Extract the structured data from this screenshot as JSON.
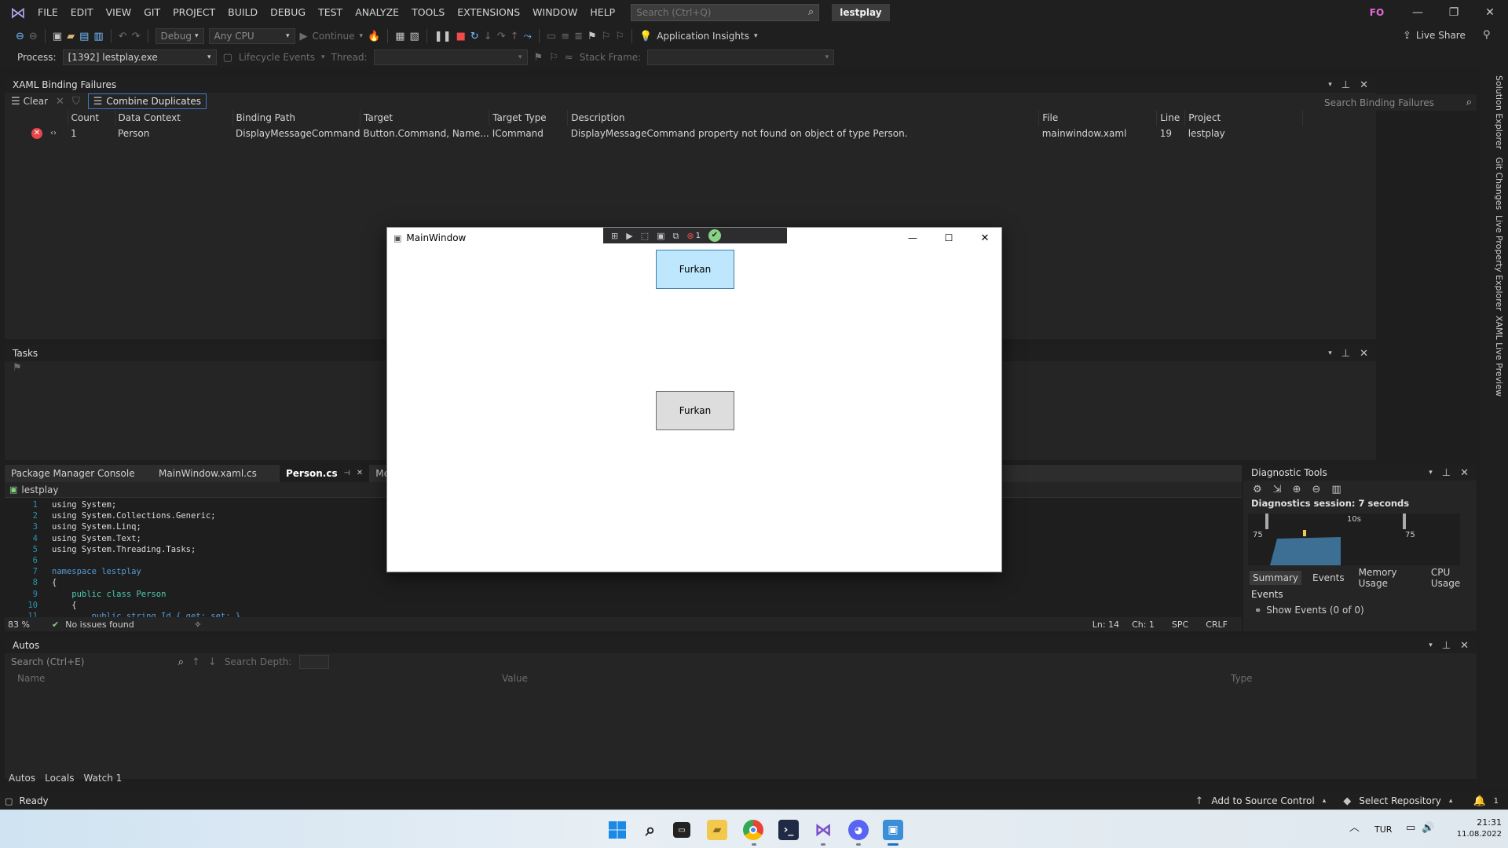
{
  "menu": {
    "items": [
      "FILE",
      "EDIT",
      "VIEW",
      "GIT",
      "PROJECT",
      "BUILD",
      "DEBUG",
      "TEST",
      "ANALYZE",
      "TOOLS",
      "EXTENSIONS",
      "WINDOW",
      "HELP"
    ],
    "search_placeholder": "Search (Ctrl+Q)",
    "solution_name": "lestplay",
    "user_initials": "FO"
  },
  "toolbar": {
    "config": "Debug",
    "platform": "Any CPU",
    "continue": "Continue",
    "app_insights": "Application Insights",
    "live_share": "Live Share",
    "process_label": "Process:",
    "process_value": "[1392] lestplay.exe",
    "lifecycle": "Lifecycle Events",
    "thread_label": "Thread:",
    "stack_frame_label": "Stack Frame:"
  },
  "binding_panel": {
    "title": "XAML Binding Failures",
    "clear": "Clear",
    "combine": "Combine Duplicates",
    "search_placeholder": "Search Binding Failures",
    "columns": [
      "Count",
      "Data Context",
      "Binding Path",
      "Target",
      "Target Type",
      "Description",
      "File",
      "Line",
      "Project"
    ],
    "rows": [
      {
        "count": "1",
        "data_context": "Person",
        "binding_path": "DisplayMessageCommand",
        "target": "Button.Command, Name...",
        "target_type": "ICommand",
        "description": "DisplayMessageCommand property not found on object of type Person.",
        "file": "mainwindow.xaml",
        "line": "19",
        "project": "lestplay"
      }
    ]
  },
  "tasks_panel": {
    "title": "Tasks"
  },
  "editor": {
    "tabs": [
      "Package Manager Console",
      "MainWindow.xaml.cs",
      "Person.cs",
      "Mess"
    ],
    "active_tab": "Person.cs",
    "project": "lestplay",
    "lines": [
      {
        "n": "1",
        "text": "using System;"
      },
      {
        "n": "2",
        "text": "using System.Collections.Generic;"
      },
      {
        "n": "3",
        "text": "using System.Linq;"
      },
      {
        "n": "4",
        "text": "using System.Text;"
      },
      {
        "n": "5",
        "text": "using System.Threading.Tasks;"
      },
      {
        "n": "6",
        "text": ""
      },
      {
        "n": "7",
        "text": "namespace lestplay"
      },
      {
        "n": "8",
        "text": "{"
      },
      {
        "n": "9",
        "text": "    public class Person"
      },
      {
        "n": "10",
        "text": "    {"
      },
      {
        "n": "11",
        "text": "        public string Id { get; set; }"
      }
    ],
    "zoom": "83 %",
    "issues": "No issues found",
    "ln": "Ln: 14",
    "ch": "Ch: 1",
    "spc": "SPC",
    "eol": "CRLF"
  },
  "diagnostics": {
    "title": "Diagnostic Tools",
    "session": "Diagnostics session: 7 seconds",
    "tick": "10s",
    "left_value": "75",
    "right_value": "75",
    "tabs": [
      "Summary",
      "Events",
      "Memory Usage",
      "CPU Usage"
    ],
    "active_tab": "Summary",
    "events_header": "Events",
    "show_events": "Show Events (0 of 0)"
  },
  "autos": {
    "title": "Autos",
    "search_placeholder": "Search (Ctrl+E)",
    "search_depth": "Search Depth:",
    "columns": [
      "Name",
      "Value",
      "Type"
    ],
    "tabs": [
      "Autos",
      "Locals",
      "Watch 1"
    ]
  },
  "status": {
    "ready": "Ready",
    "source_control": "Add to Source Control",
    "repository": "Select Repository",
    "notifications": "1"
  },
  "taskbar": {
    "lang": "TUR",
    "time": "21:31",
    "date": "11.08.2022"
  },
  "side_tabs": [
    "Solution Explorer",
    "Git Changes",
    "Live Property Explorer",
    "XAML Live Preview"
  ],
  "main_window": {
    "title": "MainWindow",
    "debug_counter": "1",
    "button1": "Furkan",
    "button2": "Furkan"
  },
  "colors": {
    "accent": "#3b78c3",
    "error": "#e8464a",
    "button_highlight": "#bee6fd"
  }
}
